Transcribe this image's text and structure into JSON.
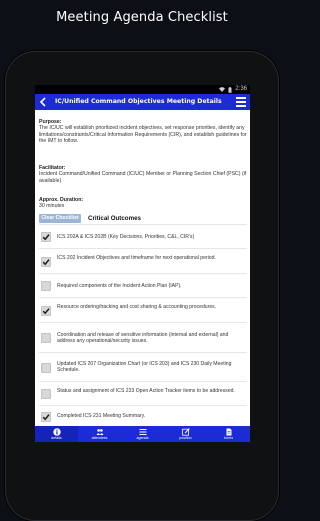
{
  "header": {
    "title": "Meeting Agenda Checklist"
  },
  "status_bar": {
    "time": "2:36"
  },
  "app_bar": {
    "title": "IC/Unified Command Objectives Meeting Details"
  },
  "details": {
    "purpose_label": "Purpose:",
    "purpose_text": "The IC/UC will establish prioritized incident objectives, set response priorities, identify any limitations/constraints/Critical Information Requirements (CIR), and establish guidelines for the IMT to follow.",
    "facilitator_label": "Facilitator:",
    "facilitator_text": "Incident Command/Unified Command (IC/UC) Member or Planning Section Chief (PSC) (if available)",
    "duration_label": "Approx. Duration:",
    "duration_text": "30 minutes"
  },
  "checklist": {
    "clear_label": "Clear Checklist",
    "title": "Critical Outcomes",
    "items": [
      {
        "text": "ICS 202A & ICS 202B (Key Decisions, Priorities, C&L, CIR's)",
        "checked": true
      },
      {
        "text": "ICS 202 Incident Objectives and timeframe for next operational period.",
        "checked": true
      },
      {
        "text": "Required components of the Incident Action Plan (IAP).",
        "checked": false
      },
      {
        "text": "Resource ordering/tracking and cost sharing & accounting procedures.",
        "checked": true
      },
      {
        "text": "Coordination and release of sensitive information (internal and external) and address any operational/security issues.",
        "checked": false
      },
      {
        "text": "Updated ICS 207 Organization Chart (or ICS 203) and ICS 230 Daily Meeting Schedule.",
        "checked": false
      },
      {
        "text": "Status and assignment of ICS 233 Open Action Tracker items to be addressed.",
        "checked": false
      },
      {
        "text": "Completed ICS 231 Meeting Summary.",
        "checked": true
      }
    ]
  },
  "bottom_nav": {
    "items": [
      {
        "label": "details",
        "icon": "info-icon"
      },
      {
        "label": "attendees",
        "icon": "people-icon"
      },
      {
        "label": "agenda",
        "icon": "list-icon"
      },
      {
        "label": "position",
        "icon": "edit-icon"
      },
      {
        "label": "forms",
        "icon": "document-icon"
      }
    ]
  },
  "colors": {
    "primary": "#1c2bd6",
    "clear_button": "#9bb6d4"
  }
}
